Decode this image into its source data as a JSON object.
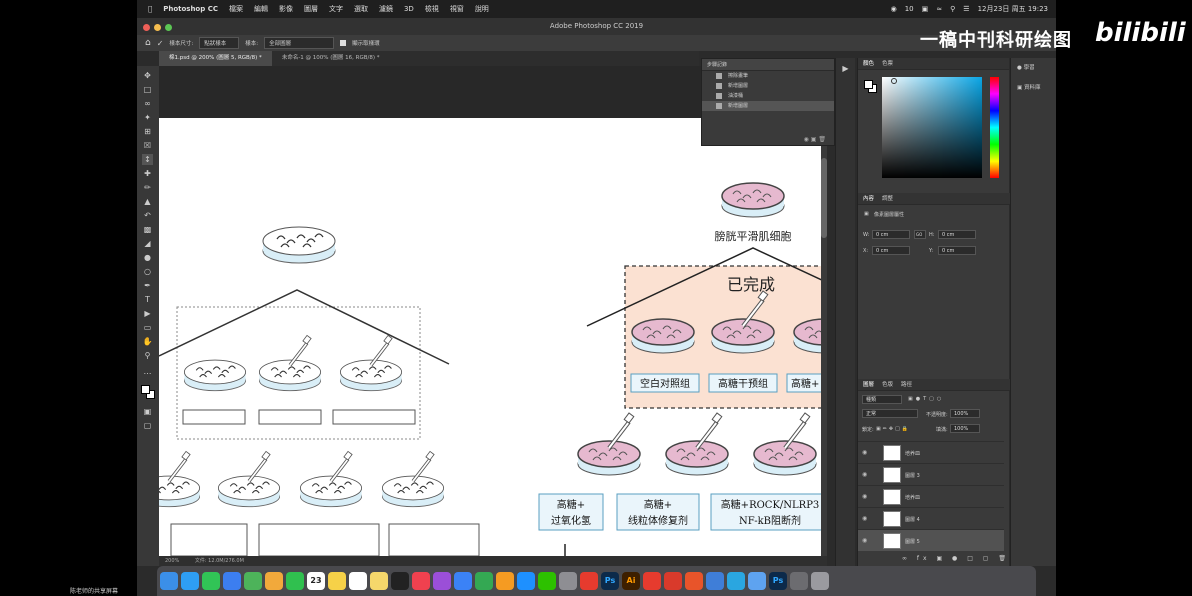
{
  "menubar": {
    "app": "Photoshop CC",
    "items": [
      "檔案",
      "編輯",
      "影像",
      "圖層",
      "文字",
      "選取",
      "濾鏡",
      "3D",
      "檢視",
      "視窗",
      "說明"
    ],
    "battery": "10",
    "datetime": "12月23日 周五  19:23"
  },
  "window": {
    "title": "Adobe Photoshop CC 2019"
  },
  "options": {
    "sample_size_label": "樣本尺寸:",
    "sample_size_value": "點狀樣本",
    "sample_label": "樣本:",
    "sample_value": "全部圖層",
    "show_ring": "顯示取樣環"
  },
  "tabs": [
    {
      "label": "棉1.psd @ 200% (圖層 5, RGB/8) *"
    },
    {
      "label": "未命名-1 @ 100% (圖層 16, RGB/8) *"
    }
  ],
  "canvas": {
    "smooth_muscle": "膀胱平滑肌细胞",
    "completed": "已完成",
    "groups_row1": [
      "空白对照组",
      "高糖干预组",
      "高糖+"
    ],
    "groups_row2": [
      {
        "line1": "高糖+",
        "line2": "过氧化氢"
      },
      {
        "line1": "高糖+",
        "line2": "线粒体修复剂"
      },
      {
        "line1": "高糖+ROCK/NLRP3",
        "line2": "NF-kB阻断剂"
      }
    ]
  },
  "statusbar": {
    "zoom": "200%",
    "doc": "文件: 12.0M/276.0M"
  },
  "history": {
    "title": "步驟記錄",
    "items": [
      "擦除畫筆",
      "新增圖層",
      "油漆桶",
      "新增圖層"
    ]
  },
  "color_panel": {
    "tabs": [
      "顏色",
      "色票"
    ]
  },
  "properties": {
    "tabs": [
      "內容",
      "調整"
    ],
    "title": "像素圖層屬性",
    "w_label": "W:",
    "w_value": "0 cm",
    "h_label": "H:",
    "h_value": "0 cm",
    "x_label": "X:",
    "x_value": "0 cm",
    "y_label": "Y:",
    "y_value": "0 cm",
    "link": "GO"
  },
  "layers_panel": {
    "tabs": [
      "圖層",
      "色版",
      "路徑"
    ],
    "kind": "種類",
    "blend_mode": "正常",
    "opacity_label": "不透明度:",
    "opacity_value": "100%",
    "lock_label": "鎖定:",
    "fill_label": "填滿:",
    "fill_value": "100%",
    "layers": [
      "培养皿",
      "圖層 3",
      "培养皿",
      "圖層 4",
      "圖層 5"
    ]
  },
  "far_right": {
    "items": [
      "學習",
      "資料庫"
    ]
  },
  "dock_apps": [
    "Finder",
    "Safari",
    "Messages",
    "Mail",
    "Maps",
    "Photos",
    "FaceTime",
    "Calendar",
    "Notes",
    "Reminders",
    "Stickies",
    "TV",
    "Music",
    "Podcasts",
    "Keynote",
    "Numbers",
    "Pages",
    "App Store",
    "WeChat",
    "Settings",
    "Acrobat",
    "Ps",
    "Ai",
    "Baidu",
    "WPS",
    "Office",
    "Cloud",
    "Files",
    "Preview",
    "Ps2",
    "Misc",
    "Trash"
  ],
  "calendar_day": "23",
  "watermark": "一稿中刊科研绘图",
  "bili_logo": "bilibili",
  "share_caption": "陈老师的共享屏幕",
  "colors": {
    "accent": "#0aa6e6",
    "complete_box": "#fbe1d2",
    "label_border": "#5a9fc0",
    "dish_pink": "#e6b9cf"
  }
}
